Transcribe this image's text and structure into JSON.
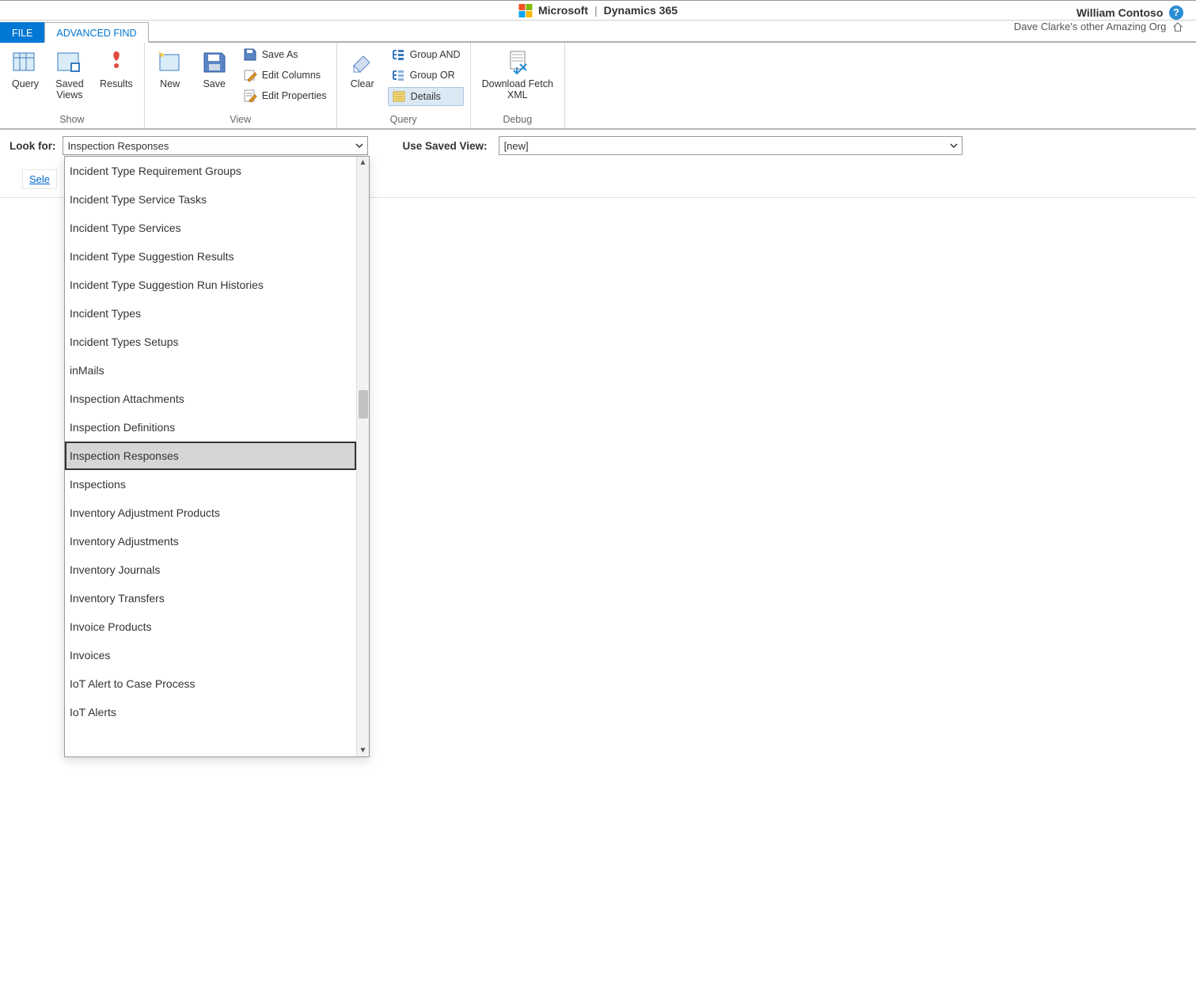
{
  "header": {
    "brand_ms": "Microsoft",
    "brand_prod": "Dynamics 365",
    "user_name": "William Contoso",
    "org_name": "Dave Clarke's other Amazing Org"
  },
  "tabs": {
    "file": "FILE",
    "advanced_find": "ADVANCED FIND"
  },
  "ribbon": {
    "show": {
      "label": "Show",
      "query": "Query",
      "saved_views": "Saved\nViews",
      "results": "Results"
    },
    "view": {
      "label": "View",
      "new": "New",
      "save": "Save",
      "save_as": "Save As",
      "edit_columns": "Edit Columns",
      "edit_properties": "Edit Properties"
    },
    "query": {
      "label": "Query",
      "clear": "Clear",
      "group_and": "Group AND",
      "group_or": "Group OR",
      "details": "Details"
    },
    "debug": {
      "label": "Debug",
      "download_fetch_xml": "Download Fetch\nXML"
    }
  },
  "filter": {
    "look_for_label": "Look for:",
    "look_for_value": "Inspection Responses",
    "saved_view_label": "Use Saved View:",
    "saved_view_value": "[new]",
    "select_link": "Sele"
  },
  "dropdown_items": [
    "Incident Type Requirement Groups",
    "Incident Type Service Tasks",
    "Incident Type Services",
    "Incident Type Suggestion Results",
    "Incident Type Suggestion Run Histories",
    "Incident Types",
    "Incident Types Setups",
    "inMails",
    "Inspection Attachments",
    "Inspection Definitions",
    "Inspection Responses",
    "Inspections",
    "Inventory Adjustment Products",
    "Inventory Adjustments",
    "Inventory Journals",
    "Inventory Transfers",
    "Invoice Products",
    "Invoices",
    "IoT Alert to Case Process",
    "IoT Alerts"
  ],
  "dropdown_selected_index": 10
}
